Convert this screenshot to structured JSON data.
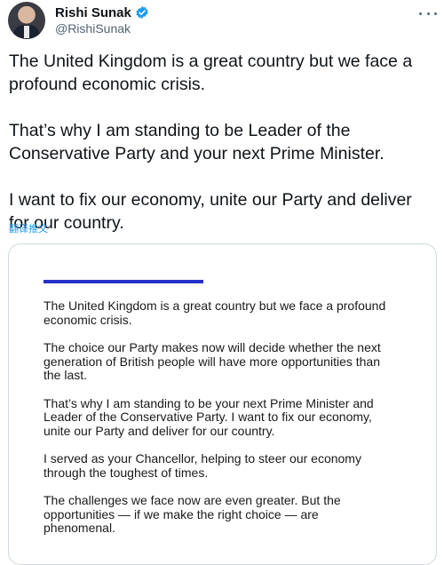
{
  "author": {
    "name": "Rishi Sunak",
    "handle": "@RishiSunak",
    "verified_icon": "verified-badge-icon",
    "verified_color": "#1d9bf0"
  },
  "tweet": {
    "paragraphs": [
      "The United Kingdom is a great country but we face a profound economic crisis.",
      "That’s why I am standing to be Leader of the Conservative Party and your next Prime Minister.",
      "I want to fix our economy, unite our Party and deliver for our country."
    ],
    "translate_label": "翻译推文"
  },
  "media": {
    "accent_color": "#2430c8",
    "paragraphs": [
      "The United Kingdom is a great country but we face a profound economic crisis.",
      "The choice our Party makes now will decide whether the next generation of British people will have more opportunities than the last.",
      "That’s why I am standing to be your next Prime Minister and Leader of the Conservative Party. I want to fix our economy, unite our Party and deliver for our country.",
      "I served as your Chancellor, helping to steer our economy through the toughest of times.",
      "The challenges we face now are even greater. But the opportunities — if we make the right choice — are phenomenal."
    ]
  },
  "icons": {
    "more": "more-options-icon",
    "avatar": "profile-avatar"
  }
}
